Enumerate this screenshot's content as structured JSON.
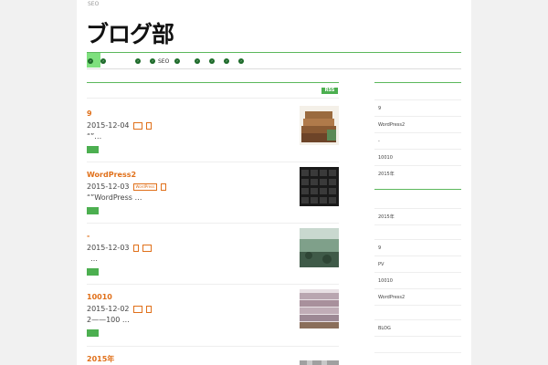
{
  "header": {
    "tag": "SEO",
    "logo": "ブログ部"
  },
  "nav": {
    "items": [
      "",
      "",
      "SEO",
      "",
      "",
      "",
      ""
    ]
  },
  "main": {
    "rss_label": "RSS",
    "posts": [
      {
        "title": "9",
        "date": "2015-12-04",
        "excerpt": "“”…"
      },
      {
        "title": "WordPress2",
        "date": "2015-12-03",
        "tag": "WordPress",
        "excerpt": "“”WordPress …"
      },
      {
        "title": "-",
        "date": "2015-12-03",
        "excerpt": "…"
      },
      {
        "title": "10010",
        "date": "2015-12-02",
        "excerpt": "2——100 …"
      },
      {
        "title": "2015年"
      }
    ]
  },
  "sidebar": {
    "group1": [
      "9",
      "WordPress2",
      "-",
      "10010",
      "2015年"
    ],
    "group2": [
      "2015年"
    ],
    "group3": [
      "9",
      "PV",
      "10010",
      "WordPress2"
    ],
    "group4": [
      "BLOG"
    ]
  }
}
